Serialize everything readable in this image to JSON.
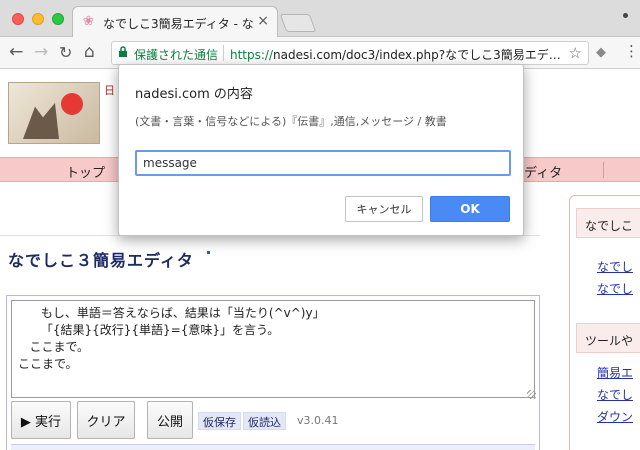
{
  "browser": {
    "tab_title": "なでしこ3簡易エディタ - なでしこ",
    "tab_close": "×",
    "secure_label": "保護された通信",
    "url_scheme": "https://",
    "url_rest": "nadesi.com/doc3/index.php?なでしこ3簡易エデ…",
    "icons": {
      "tab_favicon": "❀",
      "back": "←",
      "forward": "→",
      "reload": "↻",
      "home": "⌂",
      "lock": "🔒",
      "star": "☆",
      "extension": "◆",
      "menu": "⋮"
    }
  },
  "site": {
    "banner_fragment": "日",
    "nav_top": "トップ",
    "nav_editor": "ディタ"
  },
  "main": {
    "title": "なでしこ３簡易エディタ",
    "editor_code": "      もし、単語＝答えならば、結果は「当たり(^v^)y」\n      「{結果}{改行}{単語}={意味}」を言う。\n   ここまで。\nここまで。",
    "run_button": "▶ 実行",
    "clear_button": "クリア",
    "publish_button": "公開",
    "temp_save": "仮保存",
    "temp_load": "仮読込",
    "version": "v3.0.41"
  },
  "sidebar": {
    "head1": "なでしこ",
    "link1": "なでし",
    "link2": "なでし",
    "head2": "ツールや",
    "link3": "簡易エ",
    "link4": "なでし",
    "link5": "ダウン"
  },
  "dialog": {
    "title": "nadesi.com の内容",
    "message": "(文書・言葉・信号などによる)『伝書』,通信,メッセージ / 教書",
    "input_value": "message",
    "cancel_label": "キャンセル",
    "ok_label": "OK"
  },
  "colors": {
    "accent_ok": "#4a8af4",
    "secure_green": "#0b8043",
    "nav_bar_pink": "#f8c9c9",
    "title_navy": "#1d2a64"
  }
}
